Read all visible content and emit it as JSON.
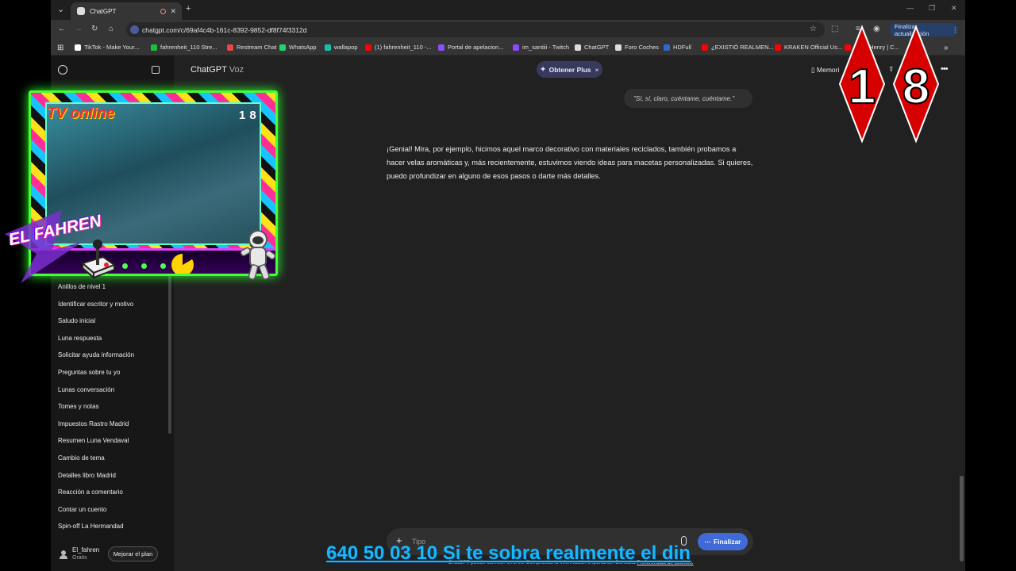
{
  "browser": {
    "tab_title": "ChatGPT",
    "url": "chatgpt.com/c/69af4c4b-161c-8392-9852-df8f74f3312d",
    "update_label": "Finalizar actualización",
    "bookmarks": [
      "TikTok - Make Your...",
      "fahrenheit_110 Stre...",
      "Restream Chat",
      "WhatsApp",
      "wallapop",
      "(1) fahrenheit_110 -...",
      "Portal de apelacion...",
      "im_santiii - Twitch",
      "ChatGPT",
      "Foro Coches",
      "HDFull",
      "¿EXISTIÓ REALMEN...",
      "KRAKEN Official Us...",
      "...ore Henry | C..."
    ]
  },
  "sidebar": {
    "chats": [
      "Anillos de nivel 1",
      "Identificar escritor y motivo",
      "Saludo inicial",
      "Luna respuesta",
      "Solicitar ayuda información",
      "Preguntas sobre tu yo",
      "Lunas conversación",
      "Tomes y notas",
      "Impuestos Rastro Madrid",
      "Resumen Luna Vendaval",
      "Cambio de tema",
      "Detalles libro Madrid",
      "Reacción a comentario",
      "Contar un cuento",
      "Spin-off La Hermandad"
    ],
    "user_name": "El_fahren",
    "user_plan": "Gratis",
    "upgrade_label": "Mejorar el plan"
  },
  "header": {
    "title": "ChatGPT",
    "mode": "Voz",
    "plus_label": "Obtener Plus",
    "memory_label": "Memori"
  },
  "chat": {
    "user_message": "\"Sí, sí, claro, cuéntame, cuéntame.\"",
    "assistant_message": "¡Genial! Mira, por ejemplo, hicimos aquel marco decorativo con materiales reciclados, también probamos a hacer velas aromáticas y, más recientemente, estuvimos viendo ideas para macetas personalizadas. Si quieres, puedo profundizar en alguno de esos pasos o darte más detalles."
  },
  "composer": {
    "placeholder": "Tipo",
    "finish_label": "Finalizar",
    "disclaimer": "ChatGPT puede cometer errores. Comprueba la información importante. Consulta",
    "disclaimer_link": "Preferencias de cookies."
  },
  "overlay": {
    "tv_label": "TV online",
    "cam_badge": "18",
    "streamer_label": "EL FAHREN",
    "badge_digits": [
      "1",
      "8"
    ],
    "ticker_text": "640 50 03 10 Si te sobra realmente el din"
  },
  "colors": {
    "accent_blue": "#3f6ad8",
    "neon_green": "#44ff33",
    "badge_red": "#e00000",
    "ticker_blue": "#18b8ff"
  }
}
